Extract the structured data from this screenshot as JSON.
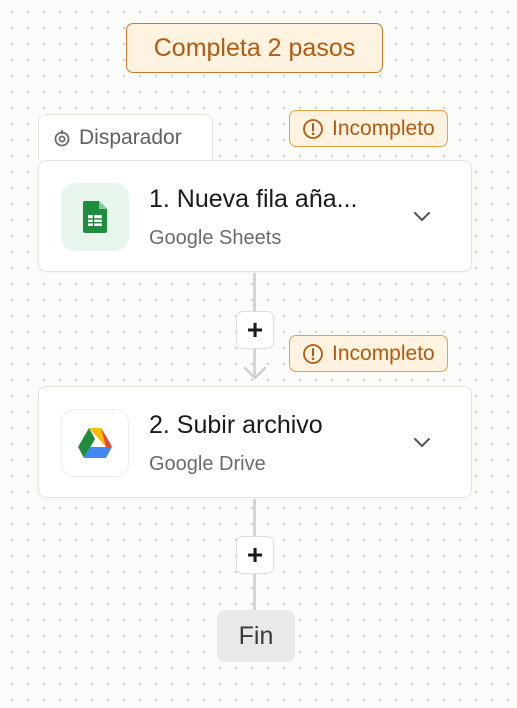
{
  "banner": {
    "text": "Completa 2 pasos"
  },
  "trigger_tab": {
    "label": "Disparador",
    "icon": "trigger-icon"
  },
  "steps": [
    {
      "title": "1. Nueva fila aña...",
      "subtitle": "Google Sheets",
      "status": "Incompleto",
      "icon": "google-sheets-icon"
    },
    {
      "title": "2. Subir archivo",
      "subtitle": "Google Drive",
      "status": "Incompleto",
      "icon": "google-drive-icon"
    }
  ],
  "add_step": {
    "label": "+"
  },
  "end": {
    "label": "Fin"
  },
  "colors": {
    "warning_bg": "#fdf3e0",
    "warning_border": "#e4a240",
    "warning_text": "#b35a10",
    "sheets_green": "#1e8e3e"
  }
}
